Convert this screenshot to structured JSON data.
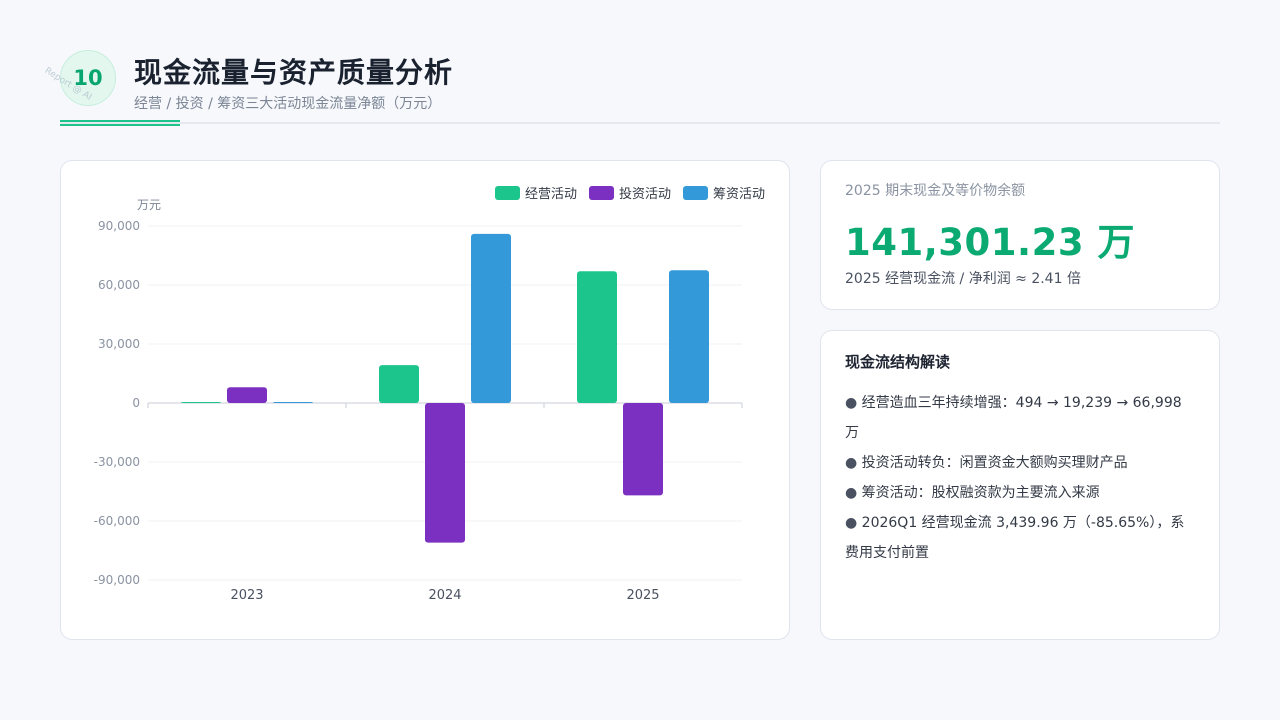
{
  "header": {
    "badge": "10",
    "title": "现金流量与资产质量分析",
    "subtitle": "经营 / 投资 / 筹资三大活动现金流量净额（万元）",
    "watermark": "Report @ AI"
  },
  "colors": {
    "operating": "#1bc58b",
    "investing": "#7b30c1",
    "financing": "#3399d8",
    "accent": "#0aaa72"
  },
  "chart_data": {
    "type": "bar",
    "unit_label": "万元",
    "categories": [
      "2023",
      "2024",
      "2025"
    ],
    "series": [
      {
        "name": "经营活动",
        "color": "#1bc58b",
        "values": [
          494,
          19239,
          66998
        ]
      },
      {
        "name": "投资活动",
        "color": "#7b30c1",
        "values": [
          8000,
          -71000,
          -47000
        ]
      },
      {
        "name": "筹资活动",
        "color": "#3399d8",
        "values": [
          300,
          86000,
          67500
        ]
      }
    ],
    "ylim": [
      -90000,
      90000
    ],
    "yticks": [
      90000,
      60000,
      30000,
      0,
      -30000,
      -60000,
      -90000
    ],
    "ytick_labels": [
      "90,000",
      "60,000",
      "30,000",
      "0",
      "-30,000",
      "-60,000",
      "-90,000"
    ],
    "grid": true,
    "legend_position": "top-right"
  },
  "balance": {
    "label": "2025 期末现金及等价物余额",
    "value": "141,301.23 万",
    "note": "2025 经营现金流 / 净利润 ≈ 2.41 倍"
  },
  "insights": {
    "title": "现金流结构解读",
    "items": [
      "经营造血三年持续增强：494 → 19,239 → 66,998 万",
      "投资活动转负：闲置资金大额购买理财产品",
      "筹资活动：股权融资款为主要流入来源",
      "2026Q1 经营现金流 3,439.96 万（-85.65%），系费用支付前置"
    ]
  }
}
